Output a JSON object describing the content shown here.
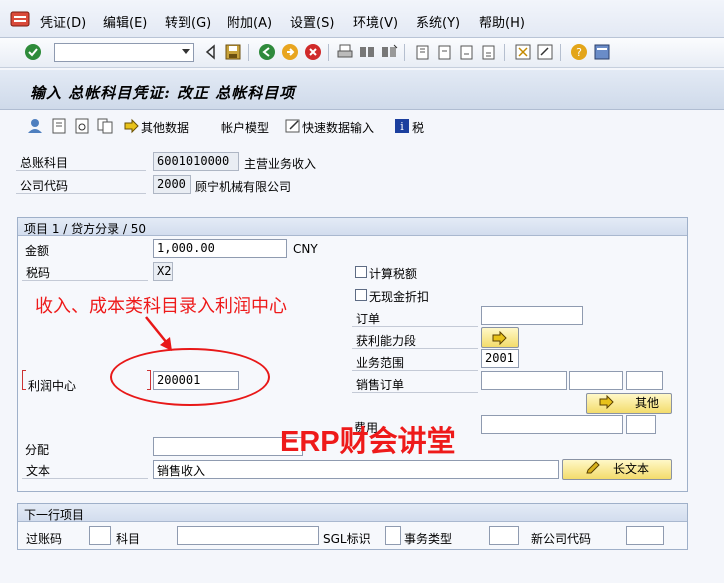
{
  "menu": [
    "凭证(D)",
    "编辑(E)",
    "转到(G)",
    "附加(A)",
    "设置(S)",
    "环境(V)",
    "系统(Y)",
    "帮助(H)"
  ],
  "page_title": "输入 总帐科目凭证: 改正 总帐科目项",
  "app_toolbar": {
    "other_data": "其他数据",
    "account_model": "帐户模型",
    "fast_entry": "快速数据输入",
    "tax": "税"
  },
  "header": {
    "gl_label": "总账科目",
    "gl_value": "6001010000",
    "gl_text": "主营业务收入",
    "company_label": "公司代码",
    "company_value": "2000",
    "company_text": "顾宁机械有限公司"
  },
  "item_group": {
    "title": "项目 1 / 贷方分录 / 50",
    "amount_label": "金额",
    "amount_value": "1,000.00",
    "currency": "CNY",
    "tax_code_label": "税码",
    "tax_code_value": "X2",
    "calc_tax": "计算税额",
    "no_cash_discount": "无现金折扣",
    "order_label": "订单",
    "profit_segment_label": "获利能力段",
    "business_area_label": "业务范围",
    "business_area_value": "2001",
    "sales_order_label": "销售订单",
    "other_button": "其他",
    "cost_label": "费用",
    "profit_center_label": "利润中心",
    "profit_center_value": "200001",
    "assignment_label": "分配",
    "text_label": "文本",
    "text_value": "销售收入",
    "long_text_button": "长文本"
  },
  "next_group": {
    "title": "下一行项目",
    "posting_key": "过账码",
    "account": "科目",
    "sgl": "SGL标识",
    "trans_type": "事务类型",
    "new_company": "新公司代码"
  },
  "annotation": "收入、成本类科目录入利润中心",
  "watermark": "ERP财会讲堂",
  "colors": {
    "annotation": "#ee1a1a",
    "button": "#f3dc6c",
    "header": "#d3ddee"
  }
}
